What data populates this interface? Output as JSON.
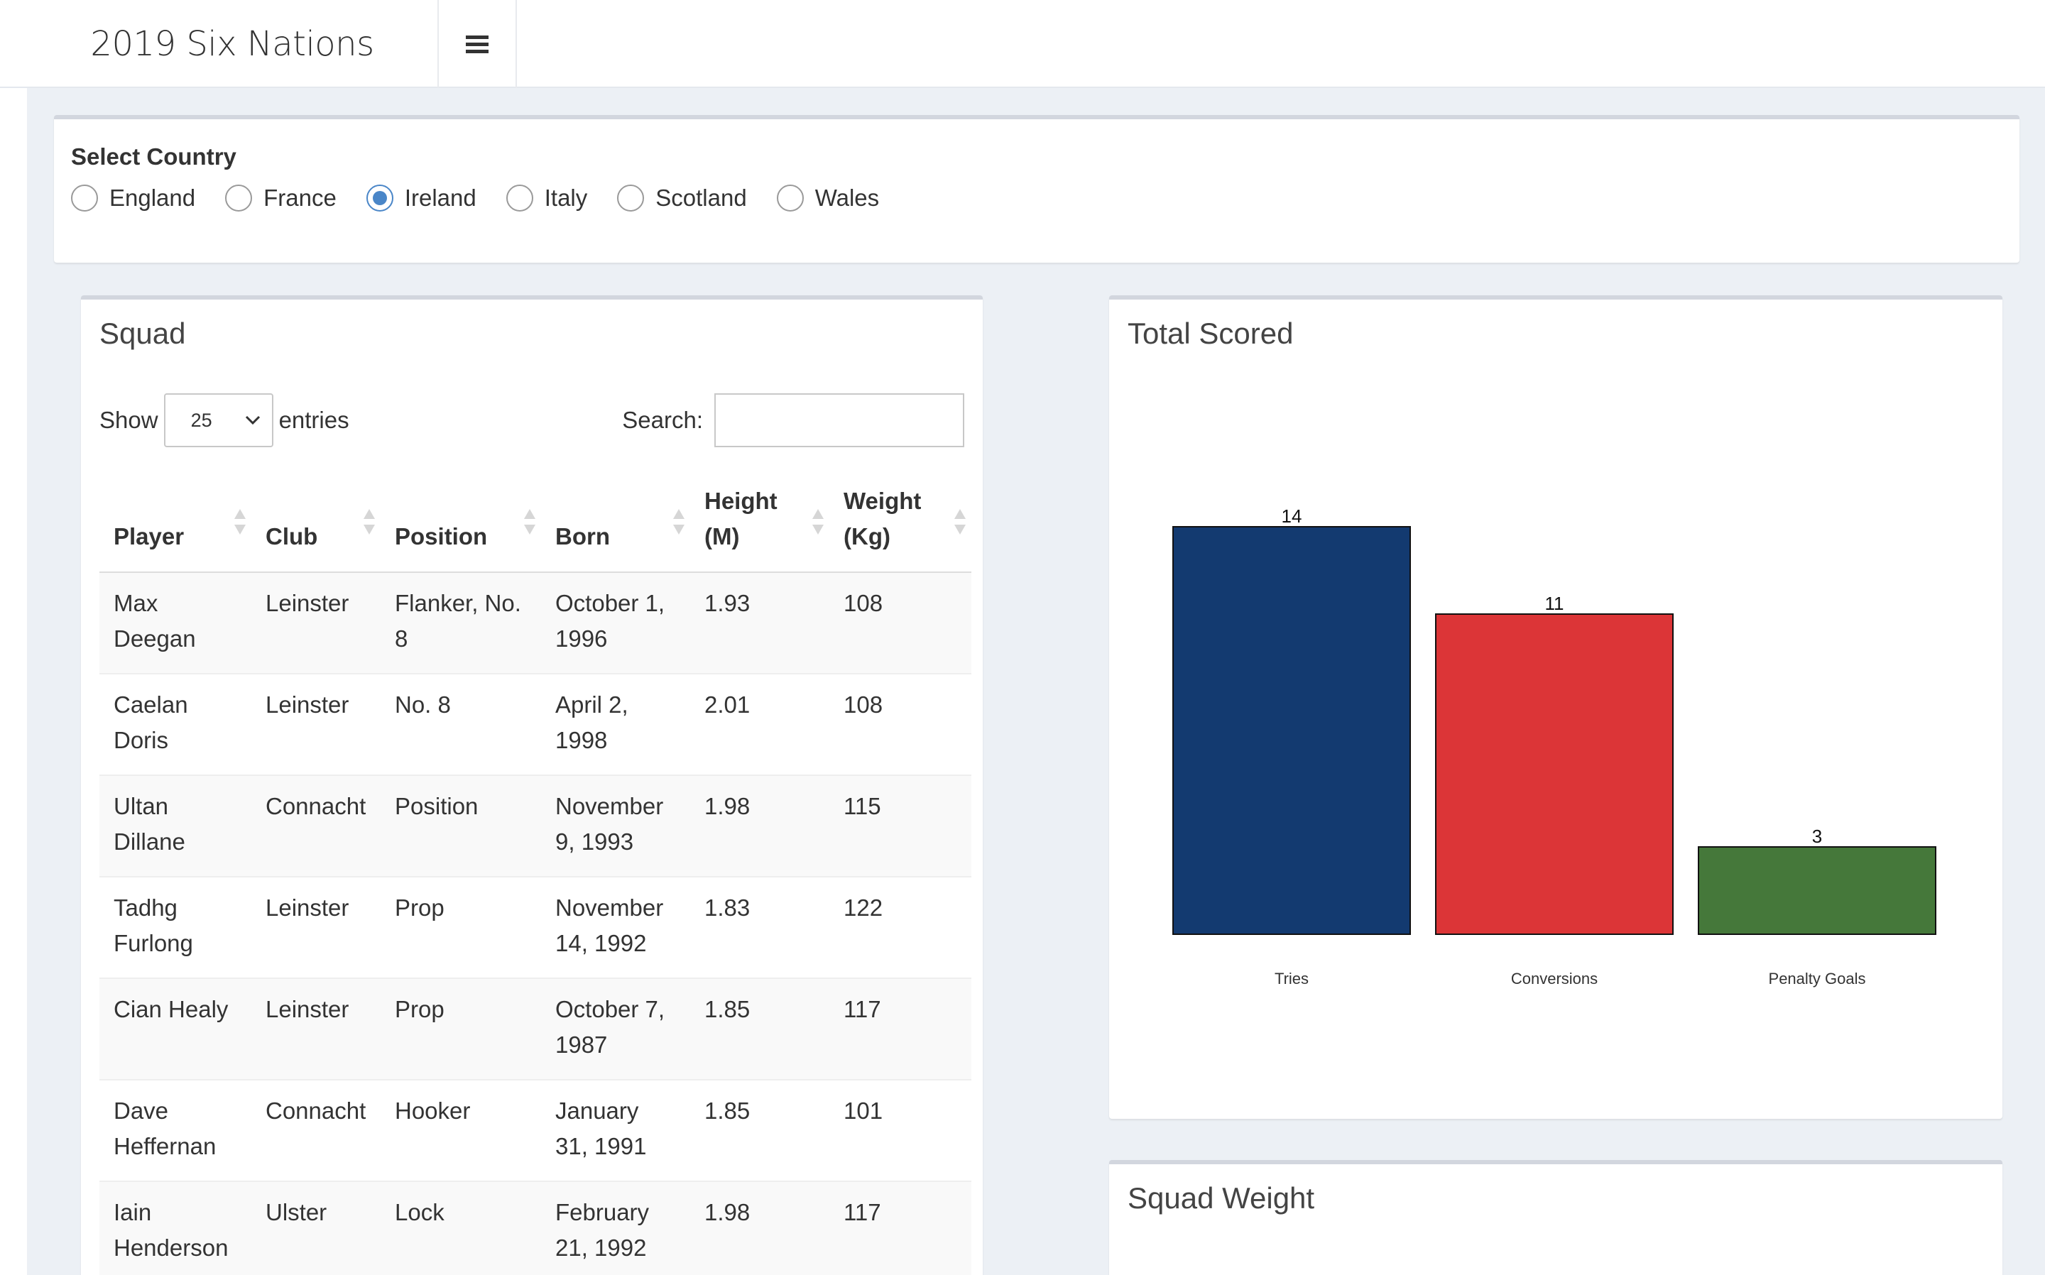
{
  "header": {
    "title": "2019 Six Nations"
  },
  "country_selector": {
    "label": "Select Country",
    "options": [
      "England",
      "France",
      "Ireland",
      "Italy",
      "Scotland",
      "Wales"
    ],
    "selected": "Ireland"
  },
  "squad": {
    "title": "Squad",
    "show_label": "Show",
    "entries_value": "25",
    "entries_label": "entries",
    "search_label": "Search:",
    "search_value": "",
    "columns": [
      "Player",
      "Club",
      "Position",
      "Born",
      "Height (M)",
      "Weight (Kg)"
    ],
    "column_lines": [
      [
        "Player"
      ],
      [
        "Club"
      ],
      [
        "Position"
      ],
      [
        "Born"
      ],
      [
        "Height",
        "(M)"
      ],
      [
        "Weight",
        "(Kg)"
      ]
    ],
    "rows": [
      {
        "player": "Max Deegan",
        "club": "Leinster",
        "position": "Flanker, No. 8",
        "born": "October 1, 1996",
        "height": "1.93",
        "weight": "108"
      },
      {
        "player": "Caelan Doris",
        "club": "Leinster",
        "position": "No. 8",
        "born": "April 2, 1998",
        "height": "2.01",
        "weight": "108"
      },
      {
        "player": "Ultan Dillane",
        "club": "Connacht",
        "position": "Position",
        "born": "November 9, 1993",
        "height": "1.98",
        "weight": "115"
      },
      {
        "player": "Tadhg Furlong",
        "club": "Leinster",
        "position": "Prop",
        "born": "November 14, 1992",
        "height": "1.83",
        "weight": "122"
      },
      {
        "player": "Cian Healy",
        "club": "Leinster",
        "position": "Prop",
        "born": "October 7, 1987",
        "height": "1.85",
        "weight": "117"
      },
      {
        "player": "Dave Heffernan",
        "club": "Connacht",
        "position": "Hooker",
        "born": "January 31, 1991",
        "height": "1.85",
        "weight": "101"
      },
      {
        "player": "Iain Henderson",
        "club": "Ulster",
        "position": "Lock",
        "born": "February 21, 1992",
        "height": "1.98",
        "weight": "117"
      }
    ]
  },
  "total_scored": {
    "title": "Total Scored"
  },
  "squad_weight": {
    "title": "Squad Weight"
  },
  "chart_data": {
    "type": "bar",
    "categories": [
      "Tries",
      "Conversions",
      "Penalty Goals"
    ],
    "values": [
      14,
      11,
      3
    ],
    "colors": [
      "#133a70",
      "#dc3537",
      "#45783a"
    ],
    "ylim": [
      0,
      14
    ],
    "data_labels": true,
    "legend": "none"
  }
}
